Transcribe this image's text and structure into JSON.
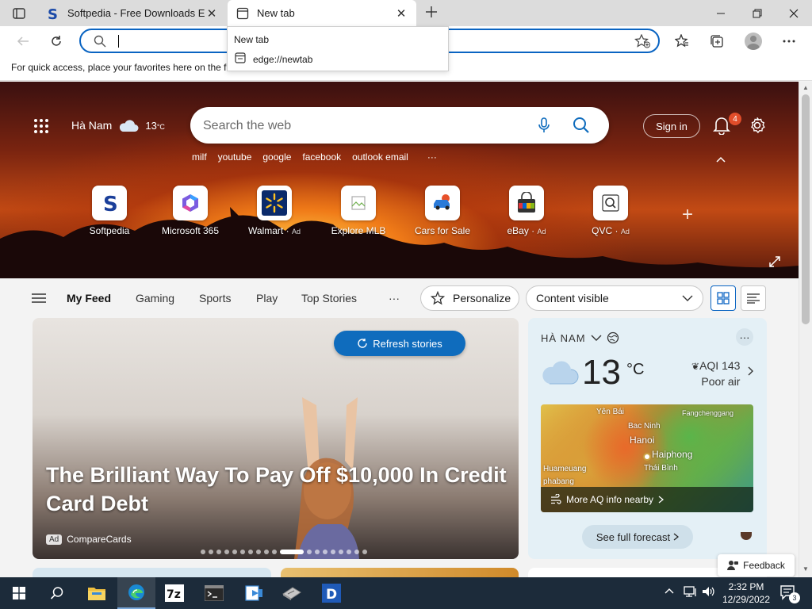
{
  "tabs": [
    {
      "title": "Softpedia - Free Downloads Encyclopedia",
      "icon": "softpedia-favicon-icon",
      "close_glyph": "✕"
    },
    {
      "title": "New tab",
      "icon": "new-tab-page-icon",
      "close_glyph": "✕"
    }
  ],
  "tab_popup": {
    "title": "New tab",
    "url": "edge://newtab"
  },
  "favorites_bar": {
    "message": "For quick access, place your favorites here on the favorites bar."
  },
  "address_bar": {
    "value": "",
    "placeholder": ""
  },
  "hero": {
    "location": "Hà Nam",
    "temperature": "13",
    "temp_unit": "°C",
    "search_placeholder": "Search the web",
    "trending": [
      "milf",
      "youtube",
      "google",
      "facebook",
      "outlook email"
    ],
    "trending_more": "···",
    "sign_in_label": "Sign in",
    "notification_count": "4",
    "add_glyph": "+"
  },
  "quick_links": [
    {
      "label": "Softpedia",
      "ad": ""
    },
    {
      "label": "Microsoft 365",
      "ad": ""
    },
    {
      "label": "Walmart",
      "ad": "Ad"
    },
    {
      "label": "Explore MLB",
      "ad": ""
    },
    {
      "label": "Cars for Sale",
      "ad": ""
    },
    {
      "label": "eBay",
      "ad": "Ad"
    },
    {
      "label": "QVC",
      "ad": "Ad"
    }
  ],
  "feed_nav": {
    "items": [
      "My Feed",
      "Gaming",
      "Sports",
      "Play",
      "Top Stories"
    ],
    "more": "···",
    "personalize_label": "Personalize",
    "content_select_value": "Content visible"
  },
  "story": {
    "headline": "The Brilliant Way To Pay Off $10,000 In Credit Card Debt",
    "ad_label": "Ad",
    "source": "CompareCards",
    "refresh_label": "Refresh stories",
    "carousel_total": 19,
    "carousel_active": 10
  },
  "weather_card": {
    "location": "HÀ NAM",
    "temperature": "13",
    "unit": "°C",
    "aqi": "AQI 143",
    "aqi_desc": "Poor air",
    "map_labels": [
      "Yên Bái",
      "Fangchenggang",
      "Bac Ninh",
      "Hanoi",
      "Haiphong",
      "Thái Bình",
      "Huameuang",
      "phabang"
    ],
    "aq_link": "More AQ info nearby",
    "forecast_label": "See full forecast",
    "more_glyph": "···"
  },
  "feedback_label": "Feedback",
  "taskbar": {
    "time": "2:32 PM",
    "date": "12/29/2022",
    "notification_count": "3",
    "apps": [
      "start-icon",
      "search-icon",
      "file-explorer-icon",
      "edge-icon",
      "7zip-icon",
      "terminal-icon",
      "migration-icon",
      "disk-icon",
      "d-app-icon"
    ]
  },
  "colors": {
    "accent": "#0a64c2",
    "refresh_button": "#0f6cbd",
    "taskbar": "#1c2b3a",
    "badge": "#e14d2a"
  }
}
